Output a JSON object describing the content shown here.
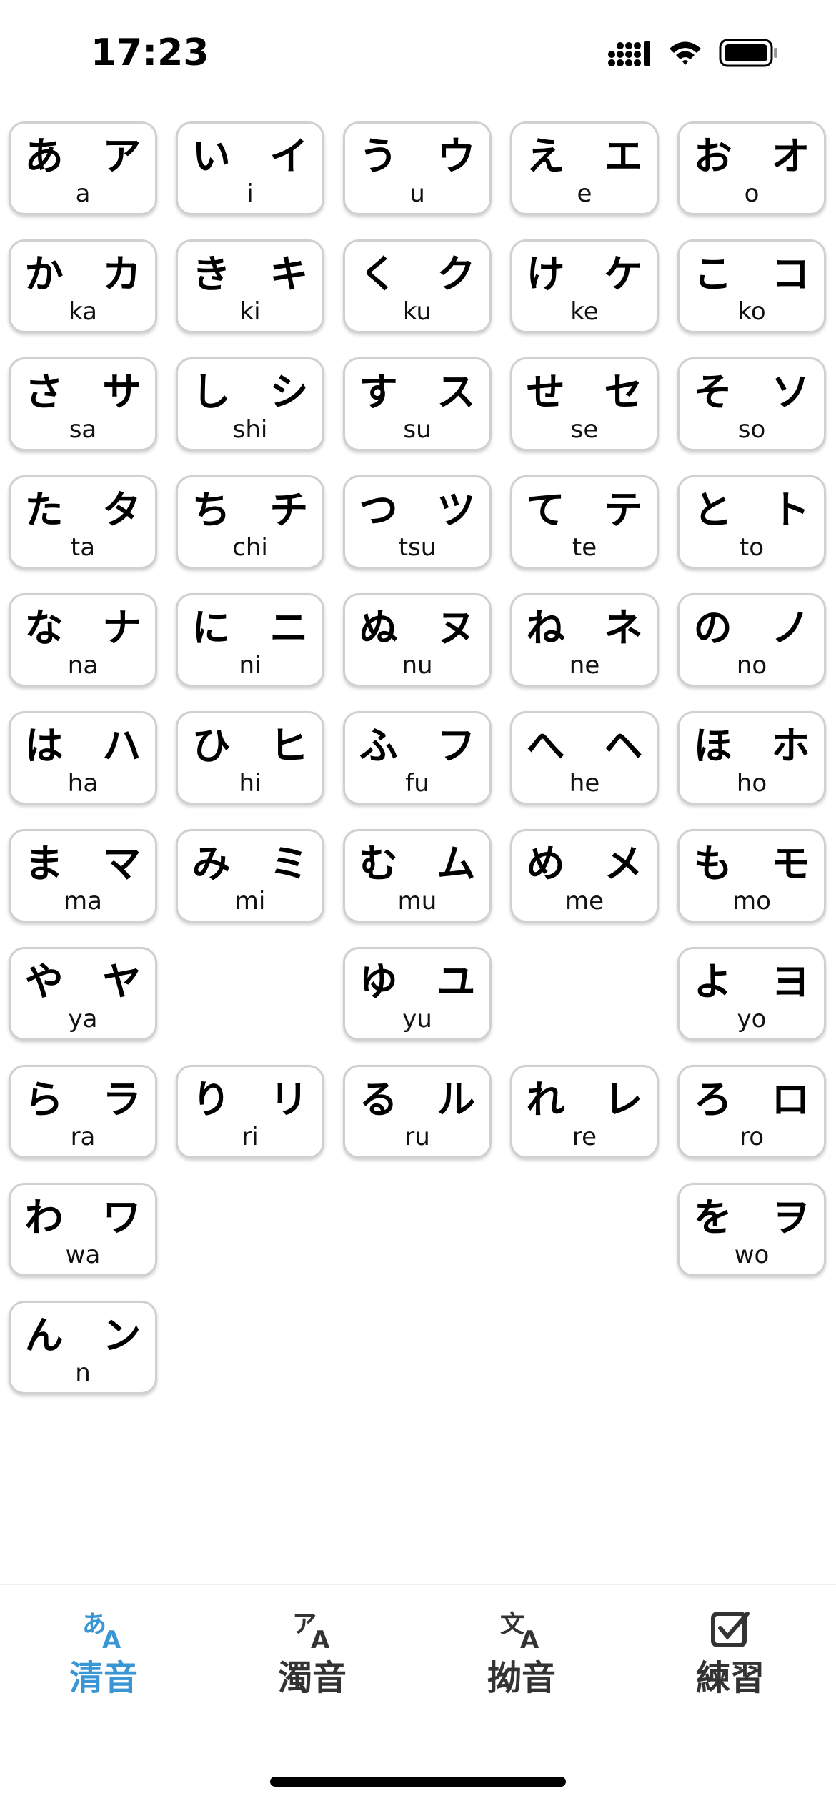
{
  "status_bar": {
    "time": "17:23",
    "battery": "battery-full-icon",
    "wifi": "wifi-icon",
    "signal": "cellular-signal-icon"
  },
  "kana_rows": [
    [
      {
        "kana": "あ ア",
        "romaji": "a"
      },
      {
        "kana": "い イ",
        "romaji": "i"
      },
      {
        "kana": "う ウ",
        "romaji": "u"
      },
      {
        "kana": "え エ",
        "romaji": "e"
      },
      {
        "kana": "お オ",
        "romaji": "o"
      }
    ],
    [
      {
        "kana": "か カ",
        "romaji": "ka"
      },
      {
        "kana": "き キ",
        "romaji": "ki"
      },
      {
        "kana": "く ク",
        "romaji": "ku"
      },
      {
        "kana": "け ケ",
        "romaji": "ke"
      },
      {
        "kana": "こ コ",
        "romaji": "ko"
      }
    ],
    [
      {
        "kana": "さ サ",
        "romaji": "sa"
      },
      {
        "kana": "し シ",
        "romaji": "shi"
      },
      {
        "kana": "す ス",
        "romaji": "su"
      },
      {
        "kana": "せ セ",
        "romaji": "se"
      },
      {
        "kana": "そ ソ",
        "romaji": "so"
      }
    ],
    [
      {
        "kana": "た タ",
        "romaji": "ta"
      },
      {
        "kana": "ち チ",
        "romaji": "chi"
      },
      {
        "kana": "つ ツ",
        "romaji": "tsu"
      },
      {
        "kana": "て テ",
        "romaji": "te"
      },
      {
        "kana": "と ト",
        "romaji": "to"
      }
    ],
    [
      {
        "kana": "な ナ",
        "romaji": "na"
      },
      {
        "kana": "に ニ",
        "romaji": "ni"
      },
      {
        "kana": "ぬ ヌ",
        "romaji": "nu"
      },
      {
        "kana": "ね ネ",
        "romaji": "ne"
      },
      {
        "kana": "の ノ",
        "romaji": "no"
      }
    ],
    [
      {
        "kana": "は ハ",
        "romaji": "ha"
      },
      {
        "kana": "ひ ヒ",
        "romaji": "hi"
      },
      {
        "kana": "ふ フ",
        "romaji": "fu"
      },
      {
        "kana": "へ ヘ",
        "romaji": "he"
      },
      {
        "kana": "ほ ホ",
        "romaji": "ho"
      }
    ],
    [
      {
        "kana": "ま マ",
        "romaji": "ma"
      },
      {
        "kana": "み ミ",
        "romaji": "mi"
      },
      {
        "kana": "む ム",
        "romaji": "mu"
      },
      {
        "kana": "め メ",
        "romaji": "me"
      },
      {
        "kana": "も モ",
        "romaji": "mo"
      }
    ],
    [
      {
        "kana": "や ヤ",
        "romaji": "ya"
      },
      null,
      {
        "kana": "ゆ ユ",
        "romaji": "yu"
      },
      null,
      {
        "kana": "よ ヨ",
        "romaji": "yo"
      }
    ],
    [
      {
        "kana": "ら ラ",
        "romaji": "ra"
      },
      {
        "kana": "り リ",
        "romaji": "ri"
      },
      {
        "kana": "る ル",
        "romaji": "ru"
      },
      {
        "kana": "れ レ",
        "romaji": "re"
      },
      {
        "kana": "ろ ロ",
        "romaji": "ro"
      }
    ],
    [
      {
        "kana": "わ ワ",
        "romaji": "wa"
      },
      null,
      null,
      null,
      {
        "kana": "を ヲ",
        "romaji": "wo"
      }
    ],
    [
      {
        "kana": "ん ン",
        "romaji": "n"
      },
      null,
      null,
      null,
      null
    ]
  ],
  "tabs": [
    {
      "label": "清音",
      "icon": "hiragana-icon",
      "active": true
    },
    {
      "label": "濁音",
      "icon": "katakana-icon",
      "active": false
    },
    {
      "label": "拗音",
      "icon": "kanji-translate-icon",
      "active": false
    },
    {
      "label": "練習",
      "icon": "checkbox-icon",
      "active": false
    }
  ],
  "colors": {
    "accent": "#3a95d4",
    "tab_inactive": "#333333",
    "card_border": "#d0d0d0"
  }
}
